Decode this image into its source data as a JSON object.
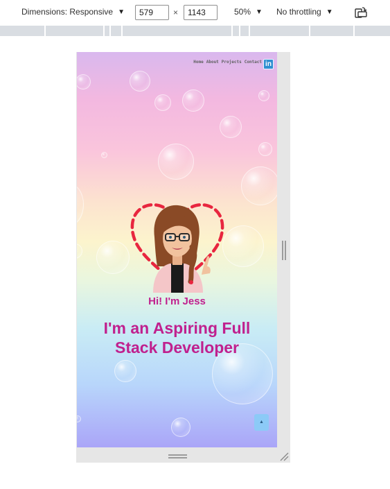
{
  "devtools": {
    "dimensions_label": "Dimensions: Responsive",
    "width_value": "579",
    "times_sign": "×",
    "height_value": "1143",
    "zoom_label": "50%",
    "throttling_label": "No throttling",
    "icons": {
      "dropdown": "caret-down-icon",
      "rotate": "rotate-icon",
      "resize": "resize-handle-icon"
    }
  },
  "page": {
    "nav": [
      "Home",
      "About",
      "Projects",
      "Contact"
    ],
    "linkedin_icon_text": "in",
    "greeting": "Hi! I'm Jess",
    "headline": "I'm an Aspiring Full Stack Developer",
    "scroll_top_glyph": "▲",
    "colors": {
      "accent": "#c0208e",
      "heart": "#e8263f",
      "linkedin": "#2f8fd1",
      "scroll_button": "#8ccaf7"
    }
  }
}
